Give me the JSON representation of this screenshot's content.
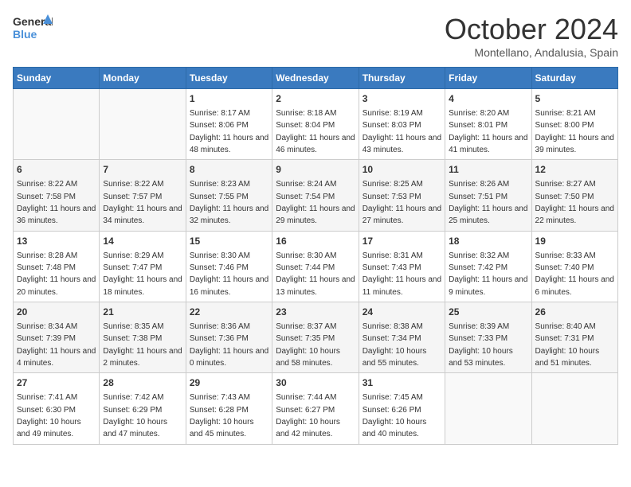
{
  "header": {
    "logo_line1": "General",
    "logo_line2": "Blue",
    "month": "October 2024",
    "location": "Montellano, Andalusia, Spain"
  },
  "weekdays": [
    "Sunday",
    "Monday",
    "Tuesday",
    "Wednesday",
    "Thursday",
    "Friday",
    "Saturday"
  ],
  "weeks": [
    [
      {
        "day": "",
        "info": ""
      },
      {
        "day": "",
        "info": ""
      },
      {
        "day": "1",
        "info": "Sunrise: 8:17 AM\nSunset: 8:06 PM\nDaylight: 11 hours and 48 minutes."
      },
      {
        "day": "2",
        "info": "Sunrise: 8:18 AM\nSunset: 8:04 PM\nDaylight: 11 hours and 46 minutes."
      },
      {
        "day": "3",
        "info": "Sunrise: 8:19 AM\nSunset: 8:03 PM\nDaylight: 11 hours and 43 minutes."
      },
      {
        "day": "4",
        "info": "Sunrise: 8:20 AM\nSunset: 8:01 PM\nDaylight: 11 hours and 41 minutes."
      },
      {
        "day": "5",
        "info": "Sunrise: 8:21 AM\nSunset: 8:00 PM\nDaylight: 11 hours and 39 minutes."
      }
    ],
    [
      {
        "day": "6",
        "info": "Sunrise: 8:22 AM\nSunset: 7:58 PM\nDaylight: 11 hours and 36 minutes."
      },
      {
        "day": "7",
        "info": "Sunrise: 8:22 AM\nSunset: 7:57 PM\nDaylight: 11 hours and 34 minutes."
      },
      {
        "day": "8",
        "info": "Sunrise: 8:23 AM\nSunset: 7:55 PM\nDaylight: 11 hours and 32 minutes."
      },
      {
        "day": "9",
        "info": "Sunrise: 8:24 AM\nSunset: 7:54 PM\nDaylight: 11 hours and 29 minutes."
      },
      {
        "day": "10",
        "info": "Sunrise: 8:25 AM\nSunset: 7:53 PM\nDaylight: 11 hours and 27 minutes."
      },
      {
        "day": "11",
        "info": "Sunrise: 8:26 AM\nSunset: 7:51 PM\nDaylight: 11 hours and 25 minutes."
      },
      {
        "day": "12",
        "info": "Sunrise: 8:27 AM\nSunset: 7:50 PM\nDaylight: 11 hours and 22 minutes."
      }
    ],
    [
      {
        "day": "13",
        "info": "Sunrise: 8:28 AM\nSunset: 7:48 PM\nDaylight: 11 hours and 20 minutes."
      },
      {
        "day": "14",
        "info": "Sunrise: 8:29 AM\nSunset: 7:47 PM\nDaylight: 11 hours and 18 minutes."
      },
      {
        "day": "15",
        "info": "Sunrise: 8:30 AM\nSunset: 7:46 PM\nDaylight: 11 hours and 16 minutes."
      },
      {
        "day": "16",
        "info": "Sunrise: 8:30 AM\nSunset: 7:44 PM\nDaylight: 11 hours and 13 minutes."
      },
      {
        "day": "17",
        "info": "Sunrise: 8:31 AM\nSunset: 7:43 PM\nDaylight: 11 hours and 11 minutes."
      },
      {
        "day": "18",
        "info": "Sunrise: 8:32 AM\nSunset: 7:42 PM\nDaylight: 11 hours and 9 minutes."
      },
      {
        "day": "19",
        "info": "Sunrise: 8:33 AM\nSunset: 7:40 PM\nDaylight: 11 hours and 6 minutes."
      }
    ],
    [
      {
        "day": "20",
        "info": "Sunrise: 8:34 AM\nSunset: 7:39 PM\nDaylight: 11 hours and 4 minutes."
      },
      {
        "day": "21",
        "info": "Sunrise: 8:35 AM\nSunset: 7:38 PM\nDaylight: 11 hours and 2 minutes."
      },
      {
        "day": "22",
        "info": "Sunrise: 8:36 AM\nSunset: 7:36 PM\nDaylight: 11 hours and 0 minutes."
      },
      {
        "day": "23",
        "info": "Sunrise: 8:37 AM\nSunset: 7:35 PM\nDaylight: 10 hours and 58 minutes."
      },
      {
        "day": "24",
        "info": "Sunrise: 8:38 AM\nSunset: 7:34 PM\nDaylight: 10 hours and 55 minutes."
      },
      {
        "day": "25",
        "info": "Sunrise: 8:39 AM\nSunset: 7:33 PM\nDaylight: 10 hours and 53 minutes."
      },
      {
        "day": "26",
        "info": "Sunrise: 8:40 AM\nSunset: 7:31 PM\nDaylight: 10 hours and 51 minutes."
      }
    ],
    [
      {
        "day": "27",
        "info": "Sunrise: 7:41 AM\nSunset: 6:30 PM\nDaylight: 10 hours and 49 minutes."
      },
      {
        "day": "28",
        "info": "Sunrise: 7:42 AM\nSunset: 6:29 PM\nDaylight: 10 hours and 47 minutes."
      },
      {
        "day": "29",
        "info": "Sunrise: 7:43 AM\nSunset: 6:28 PM\nDaylight: 10 hours and 45 minutes."
      },
      {
        "day": "30",
        "info": "Sunrise: 7:44 AM\nSunset: 6:27 PM\nDaylight: 10 hours and 42 minutes."
      },
      {
        "day": "31",
        "info": "Sunrise: 7:45 AM\nSunset: 6:26 PM\nDaylight: 10 hours and 40 minutes."
      },
      {
        "day": "",
        "info": ""
      },
      {
        "day": "",
        "info": ""
      }
    ]
  ]
}
